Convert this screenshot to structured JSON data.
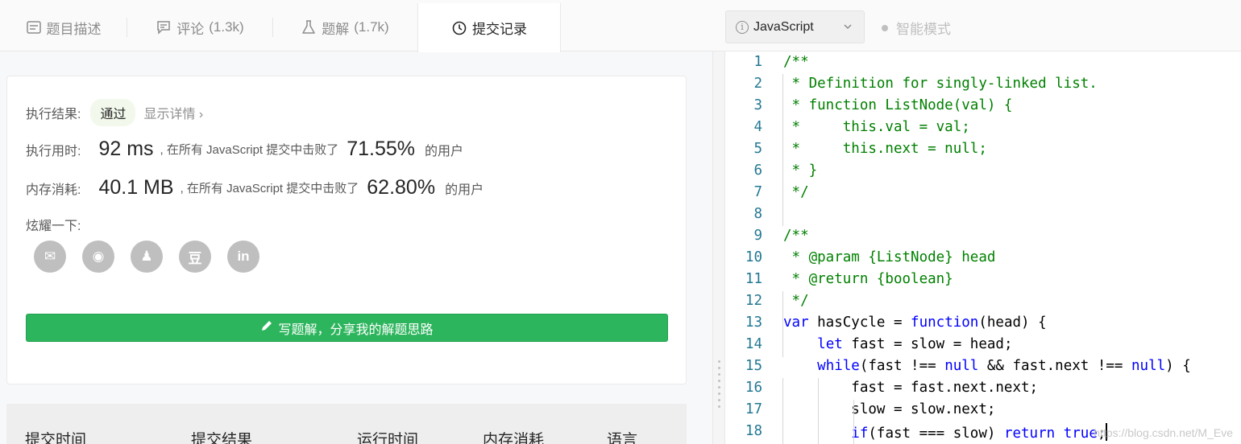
{
  "tabs": [
    {
      "label": "题目描述",
      "count": "",
      "icon": "description-icon"
    },
    {
      "label": "评论",
      "count": "(1.3k)",
      "icon": "comment-icon"
    },
    {
      "label": "题解",
      "count": "(1.7k)",
      "icon": "flask-icon"
    },
    {
      "label": "提交记录",
      "count": "",
      "icon": "clock-icon"
    }
  ],
  "result": {
    "status_label": "执行结果:",
    "status_value": "通过",
    "detail_link": "显示详情 ›",
    "runtime_label": "执行用时:",
    "runtime_value": "92 ms",
    "runtime_text": ", 在所有 JavaScript 提交中击败了",
    "runtime_pct": "71.55%",
    "runtime_users": "的用户",
    "memory_label": "内存消耗:",
    "memory_value": "40.1 MB",
    "memory_text": ", 在所有 JavaScript 提交中击败了",
    "memory_pct": "62.80%",
    "memory_users": "的用户",
    "share_label": "炫耀一下:",
    "share_icons": [
      {
        "name": "wechat-icon",
        "glyph": "✉"
      },
      {
        "name": "weibo-icon",
        "glyph": "◉"
      },
      {
        "name": "qq-icon",
        "glyph": "♟"
      },
      {
        "name": "douban-icon",
        "glyph": "豆"
      },
      {
        "name": "linkedin-icon",
        "glyph": "in"
      }
    ],
    "write_button": "写题解，分享我的解题思路"
  },
  "table": {
    "headers": [
      "提交时间",
      "提交结果",
      "运行时间",
      "内存消耗",
      "语言"
    ]
  },
  "editor": {
    "language": "JavaScript",
    "smart_mode": "智能模式",
    "lines": [
      {
        "n": "1",
        "t": "/**",
        "k": "com"
      },
      {
        "n": "2",
        "t": " * Definition for singly-linked list.",
        "k": "com"
      },
      {
        "n": "3",
        "t": " * function ListNode(val) {",
        "k": "com"
      },
      {
        "n": "4",
        "t": " *     this.val = val;",
        "k": "com"
      },
      {
        "n": "5",
        "t": " *     this.next = null;",
        "k": "com"
      },
      {
        "n": "6",
        "t": " * }",
        "k": "com"
      },
      {
        "n": "7",
        "t": " */",
        "k": "com"
      },
      {
        "n": "8",
        "t": "",
        "k": "plain"
      },
      {
        "n": "9",
        "t": "/**",
        "k": "com"
      },
      {
        "n": "10",
        "t": " * @param {ListNode} head",
        "k": "com"
      },
      {
        "n": "11",
        "t": " * @return {boolean}",
        "k": "com"
      },
      {
        "n": "12",
        "t": " */",
        "k": "com"
      },
      {
        "n": "13",
        "t": "var hasCycle = function(head) {",
        "k": "code"
      },
      {
        "n": "14",
        "t": "    let fast = slow = head;",
        "k": "code"
      },
      {
        "n": "15",
        "t": "    while(fast !== null && fast.next !== null) {",
        "k": "code"
      },
      {
        "n": "16",
        "t": "        fast = fast.next.next;",
        "k": "code"
      },
      {
        "n": "17",
        "t": "        slow = slow.next;",
        "k": "code"
      },
      {
        "n": "18",
        "t": "        if(fast === slow) return true;",
        "k": "code",
        "cursor": true
      }
    ],
    "watermark": "https://blog.csdn.net/M_Eve"
  },
  "colors": {
    "accent_green": "#2db55d",
    "keyword_blue": "#0000ff",
    "comment_green": "#008000",
    "line_number": "#237893"
  }
}
